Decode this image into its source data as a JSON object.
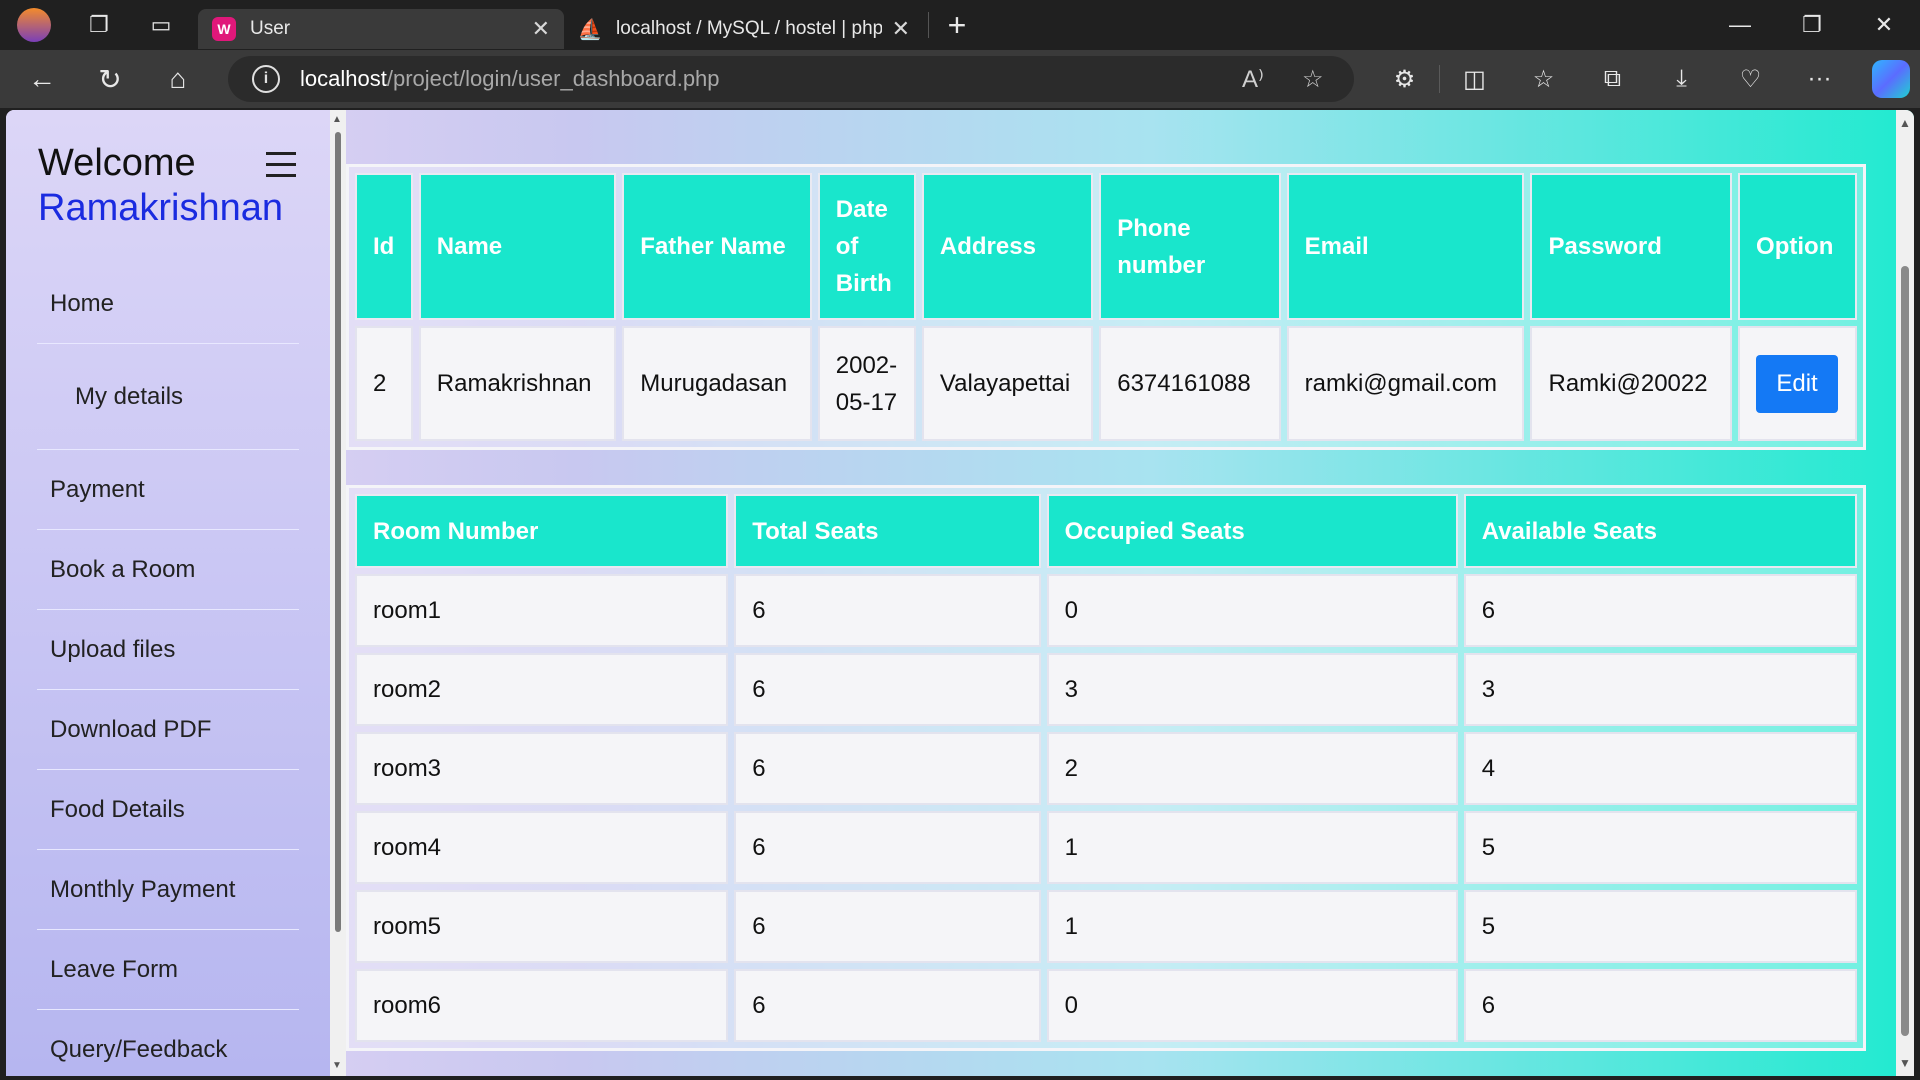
{
  "browser": {
    "tabs": [
      {
        "title": "User",
        "active": true,
        "favicon_color": "#e0187a"
      },
      {
        "title": "localhost / MySQL / hostel | phpM",
        "active": false
      }
    ],
    "url_host": "localhost",
    "url_path": "/project/login/user_dashboard.php"
  },
  "sidebar": {
    "welcome": "Welcome",
    "username": "Ramakrishnan",
    "items": [
      {
        "label": "Home"
      },
      {
        "label": "My details"
      },
      {
        "label": "Payment"
      },
      {
        "label": "Book a Room"
      },
      {
        "label": "Upload files"
      },
      {
        "label": "Download PDF"
      },
      {
        "label": "Food Details"
      },
      {
        "label": "Monthly Payment"
      },
      {
        "label": "Leave Form"
      },
      {
        "label": "Query/Feedback"
      }
    ]
  },
  "user_table": {
    "headers": [
      "Id",
      "Name",
      "Father Name",
      "Date of Birth",
      "Address",
      "Phone number",
      "Email",
      "Password",
      "Option"
    ],
    "row": {
      "id": "2",
      "name": "Ramakrishnan",
      "father_name": "Murugadasan",
      "dob": "2002-05-17",
      "address": "Valayapettai",
      "phone": "6374161088",
      "email": "ramki@gmail.com",
      "password": "Ramki@20022",
      "edit_label": "Edit"
    }
  },
  "room_table": {
    "headers": [
      "Room Number",
      "Total Seats",
      "Occupied Seats",
      "Available Seats"
    ],
    "rows": [
      [
        "room1",
        "6",
        "0",
        "6"
      ],
      [
        "room2",
        "6",
        "3",
        "3"
      ],
      [
        "room3",
        "6",
        "2",
        "4"
      ],
      [
        "room4",
        "6",
        "1",
        "5"
      ],
      [
        "room5",
        "6",
        "1",
        "5"
      ],
      [
        "room6",
        "6",
        "0",
        "6"
      ]
    ]
  },
  "colors": {
    "header_bg": "#19e6cc",
    "edit_button": "#1479f5",
    "username": "#1a2be0"
  }
}
